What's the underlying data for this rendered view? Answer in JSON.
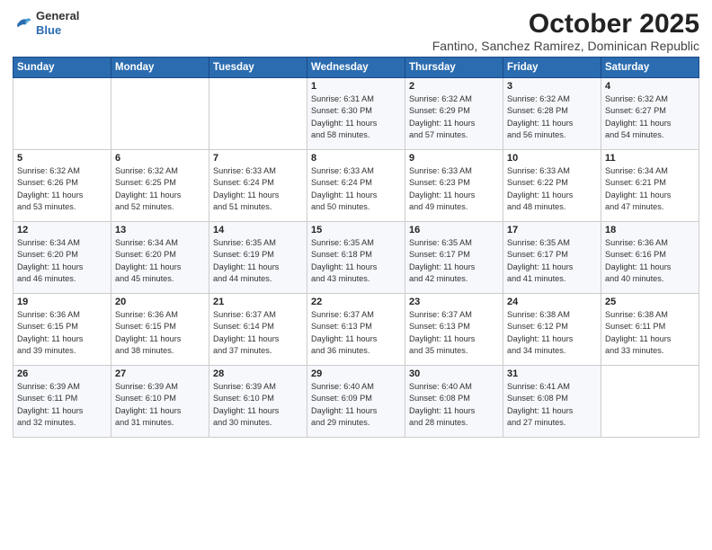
{
  "header": {
    "logo_general": "General",
    "logo_blue": "Blue",
    "month": "October 2025",
    "location": "Fantino, Sanchez Ramirez, Dominican Republic"
  },
  "days_of_week": [
    "Sunday",
    "Monday",
    "Tuesday",
    "Wednesday",
    "Thursday",
    "Friday",
    "Saturday"
  ],
  "weeks": [
    [
      {
        "day": "",
        "info": ""
      },
      {
        "day": "",
        "info": ""
      },
      {
        "day": "",
        "info": ""
      },
      {
        "day": "1",
        "info": "Sunrise: 6:31 AM\nSunset: 6:30 PM\nDaylight: 11 hours\nand 58 minutes."
      },
      {
        "day": "2",
        "info": "Sunrise: 6:32 AM\nSunset: 6:29 PM\nDaylight: 11 hours\nand 57 minutes."
      },
      {
        "day": "3",
        "info": "Sunrise: 6:32 AM\nSunset: 6:28 PM\nDaylight: 11 hours\nand 56 minutes."
      },
      {
        "day": "4",
        "info": "Sunrise: 6:32 AM\nSunset: 6:27 PM\nDaylight: 11 hours\nand 54 minutes."
      }
    ],
    [
      {
        "day": "5",
        "info": "Sunrise: 6:32 AM\nSunset: 6:26 PM\nDaylight: 11 hours\nand 53 minutes."
      },
      {
        "day": "6",
        "info": "Sunrise: 6:32 AM\nSunset: 6:25 PM\nDaylight: 11 hours\nand 52 minutes."
      },
      {
        "day": "7",
        "info": "Sunrise: 6:33 AM\nSunset: 6:24 PM\nDaylight: 11 hours\nand 51 minutes."
      },
      {
        "day": "8",
        "info": "Sunrise: 6:33 AM\nSunset: 6:24 PM\nDaylight: 11 hours\nand 50 minutes."
      },
      {
        "day": "9",
        "info": "Sunrise: 6:33 AM\nSunset: 6:23 PM\nDaylight: 11 hours\nand 49 minutes."
      },
      {
        "day": "10",
        "info": "Sunrise: 6:33 AM\nSunset: 6:22 PM\nDaylight: 11 hours\nand 48 minutes."
      },
      {
        "day": "11",
        "info": "Sunrise: 6:34 AM\nSunset: 6:21 PM\nDaylight: 11 hours\nand 47 minutes."
      }
    ],
    [
      {
        "day": "12",
        "info": "Sunrise: 6:34 AM\nSunset: 6:20 PM\nDaylight: 11 hours\nand 46 minutes."
      },
      {
        "day": "13",
        "info": "Sunrise: 6:34 AM\nSunset: 6:20 PM\nDaylight: 11 hours\nand 45 minutes."
      },
      {
        "day": "14",
        "info": "Sunrise: 6:35 AM\nSunset: 6:19 PM\nDaylight: 11 hours\nand 44 minutes."
      },
      {
        "day": "15",
        "info": "Sunrise: 6:35 AM\nSunset: 6:18 PM\nDaylight: 11 hours\nand 43 minutes."
      },
      {
        "day": "16",
        "info": "Sunrise: 6:35 AM\nSunset: 6:17 PM\nDaylight: 11 hours\nand 42 minutes."
      },
      {
        "day": "17",
        "info": "Sunrise: 6:35 AM\nSunset: 6:17 PM\nDaylight: 11 hours\nand 41 minutes."
      },
      {
        "day": "18",
        "info": "Sunrise: 6:36 AM\nSunset: 6:16 PM\nDaylight: 11 hours\nand 40 minutes."
      }
    ],
    [
      {
        "day": "19",
        "info": "Sunrise: 6:36 AM\nSunset: 6:15 PM\nDaylight: 11 hours\nand 39 minutes."
      },
      {
        "day": "20",
        "info": "Sunrise: 6:36 AM\nSunset: 6:15 PM\nDaylight: 11 hours\nand 38 minutes."
      },
      {
        "day": "21",
        "info": "Sunrise: 6:37 AM\nSunset: 6:14 PM\nDaylight: 11 hours\nand 37 minutes."
      },
      {
        "day": "22",
        "info": "Sunrise: 6:37 AM\nSunset: 6:13 PM\nDaylight: 11 hours\nand 36 minutes."
      },
      {
        "day": "23",
        "info": "Sunrise: 6:37 AM\nSunset: 6:13 PM\nDaylight: 11 hours\nand 35 minutes."
      },
      {
        "day": "24",
        "info": "Sunrise: 6:38 AM\nSunset: 6:12 PM\nDaylight: 11 hours\nand 34 minutes."
      },
      {
        "day": "25",
        "info": "Sunrise: 6:38 AM\nSunset: 6:11 PM\nDaylight: 11 hours\nand 33 minutes."
      }
    ],
    [
      {
        "day": "26",
        "info": "Sunrise: 6:39 AM\nSunset: 6:11 PM\nDaylight: 11 hours\nand 32 minutes."
      },
      {
        "day": "27",
        "info": "Sunrise: 6:39 AM\nSunset: 6:10 PM\nDaylight: 11 hours\nand 31 minutes."
      },
      {
        "day": "28",
        "info": "Sunrise: 6:39 AM\nSunset: 6:10 PM\nDaylight: 11 hours\nand 30 minutes."
      },
      {
        "day": "29",
        "info": "Sunrise: 6:40 AM\nSunset: 6:09 PM\nDaylight: 11 hours\nand 29 minutes."
      },
      {
        "day": "30",
        "info": "Sunrise: 6:40 AM\nSunset: 6:08 PM\nDaylight: 11 hours\nand 28 minutes."
      },
      {
        "day": "31",
        "info": "Sunrise: 6:41 AM\nSunset: 6:08 PM\nDaylight: 11 hours\nand 27 minutes."
      },
      {
        "day": "",
        "info": ""
      }
    ]
  ]
}
